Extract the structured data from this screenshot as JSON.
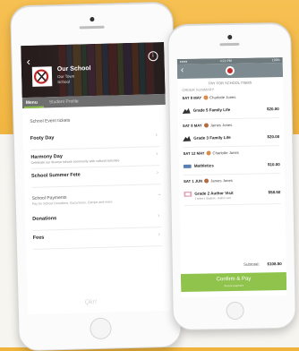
{
  "colors": {
    "background": "#f0b43a",
    "accent_green": "#8fc34b",
    "header_grey": "#7d8b90"
  },
  "left_phone": {
    "school": {
      "name": "Our School",
      "line1": "Our Town",
      "line2": "School"
    },
    "tabs": [
      {
        "label": "Menu"
      },
      {
        "label": "Student Profile"
      }
    ],
    "sections": [
      {
        "title": "School Event tickets",
        "rows": [
          {
            "title": "Footy Day",
            "subtitle": ""
          },
          {
            "title": "Harmony Day",
            "subtitle": "Celebrate our diverse school community with cultural activities"
          },
          {
            "title": "School Summer Fete",
            "subtitle": ""
          }
        ]
      },
      {
        "title": "School Payments",
        "subtitle": "Pay for School Donations, Excursions, Camps and more",
        "rows": [
          {
            "title": "Donations",
            "subtitle": ""
          },
          {
            "title": "Fees",
            "subtitle": ""
          }
        ]
      }
    ],
    "footer_logo": "Qkr!"
  },
  "right_phone": {
    "status_bar": {
      "carrier": "●●●● ",
      "time": "4:21 PM",
      "battery": "100%"
    },
    "pay_for_label": "PAY FOR SCHOOL ITEMS",
    "order_summary_label": "ORDER SUMMARY",
    "groups": [
      {
        "date": "SAT 8 MAY",
        "person": "Charlotte Jones",
        "items": [
          {
            "icon": "kangaroo-icon",
            "name": "Grade 5 Family Life",
            "price": "$20.00"
          }
        ]
      },
      {
        "date": "SAT 8 MAY",
        "person": "James Jones",
        "items": [
          {
            "icon": "kangaroo-icon",
            "name": "Grade 3 Family Life",
            "price": "$20.00"
          }
        ]
      },
      {
        "date": "SAT 12 MAY",
        "person": "Charlotte Jones",
        "items": [
          {
            "icon": "canteen-icon",
            "name": "Mathletics",
            "price": "$10.00"
          }
        ]
      },
      {
        "date": "SAT 1 JUN",
        "person": "James Jones",
        "items": [
          {
            "icon": "author-icon",
            "name": "Grade 2 Author Visit",
            "price": "$58.50",
            "subtitle": "1 ticket x Student - Author visit"
          }
        ]
      }
    ],
    "subtotal_label": "Subtotal:",
    "subtotal_value": "$108.50",
    "confirm_label": "Confirm & Pay",
    "confirm_sub": "Secure payment"
  }
}
